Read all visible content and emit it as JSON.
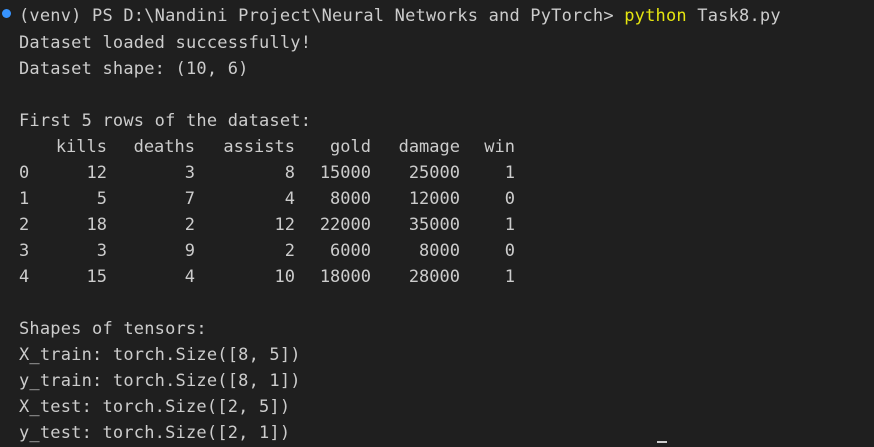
{
  "prompt": {
    "venv": "(venv)",
    "path": " PS D:\\Nandini Project\\Neural Networks and PyTorch> ",
    "command": "python",
    "args": " Task8.py"
  },
  "output": {
    "loaded": "Dataset loaded successfully!",
    "shape": "Dataset shape: (10, 6)",
    "first_rows_title": "First 5 rows of the dataset:",
    "table": {
      "columns": [
        "kills",
        "deaths",
        "assists",
        "gold",
        "damage",
        "win"
      ],
      "rows": [
        {
          "index": "0",
          "kills": "12",
          "deaths": "3",
          "assists": "8",
          "gold": "15000",
          "damage": "25000",
          "win": "1"
        },
        {
          "index": "1",
          "kills": "5",
          "deaths": "7",
          "assists": "4",
          "gold": "8000",
          "damage": "12000",
          "win": "0"
        },
        {
          "index": "2",
          "kills": "18",
          "deaths": "2",
          "assists": "12",
          "gold": "22000",
          "damage": "35000",
          "win": "1"
        },
        {
          "index": "3",
          "kills": "3",
          "deaths": "9",
          "assists": "2",
          "gold": "6000",
          "damage": "8000",
          "win": "0"
        },
        {
          "index": "4",
          "kills": "15",
          "deaths": "4",
          "assists": "10",
          "gold": "18000",
          "damage": "28000",
          "win": "1"
        }
      ]
    },
    "tensors_title": "Shapes of tensors:",
    "x_train": "X_train: torch.Size([8, 5])",
    "y_train": "y_train: torch.Size([8, 1])",
    "x_test": "X_test: torch.Size([2, 5])",
    "y_test": "y_test: torch.Size([2, 1])"
  },
  "colors": {
    "background": "#1f1f1f",
    "text": "#cccccc",
    "command": "#e5e510",
    "prompt_dot": "#3794ff"
  }
}
